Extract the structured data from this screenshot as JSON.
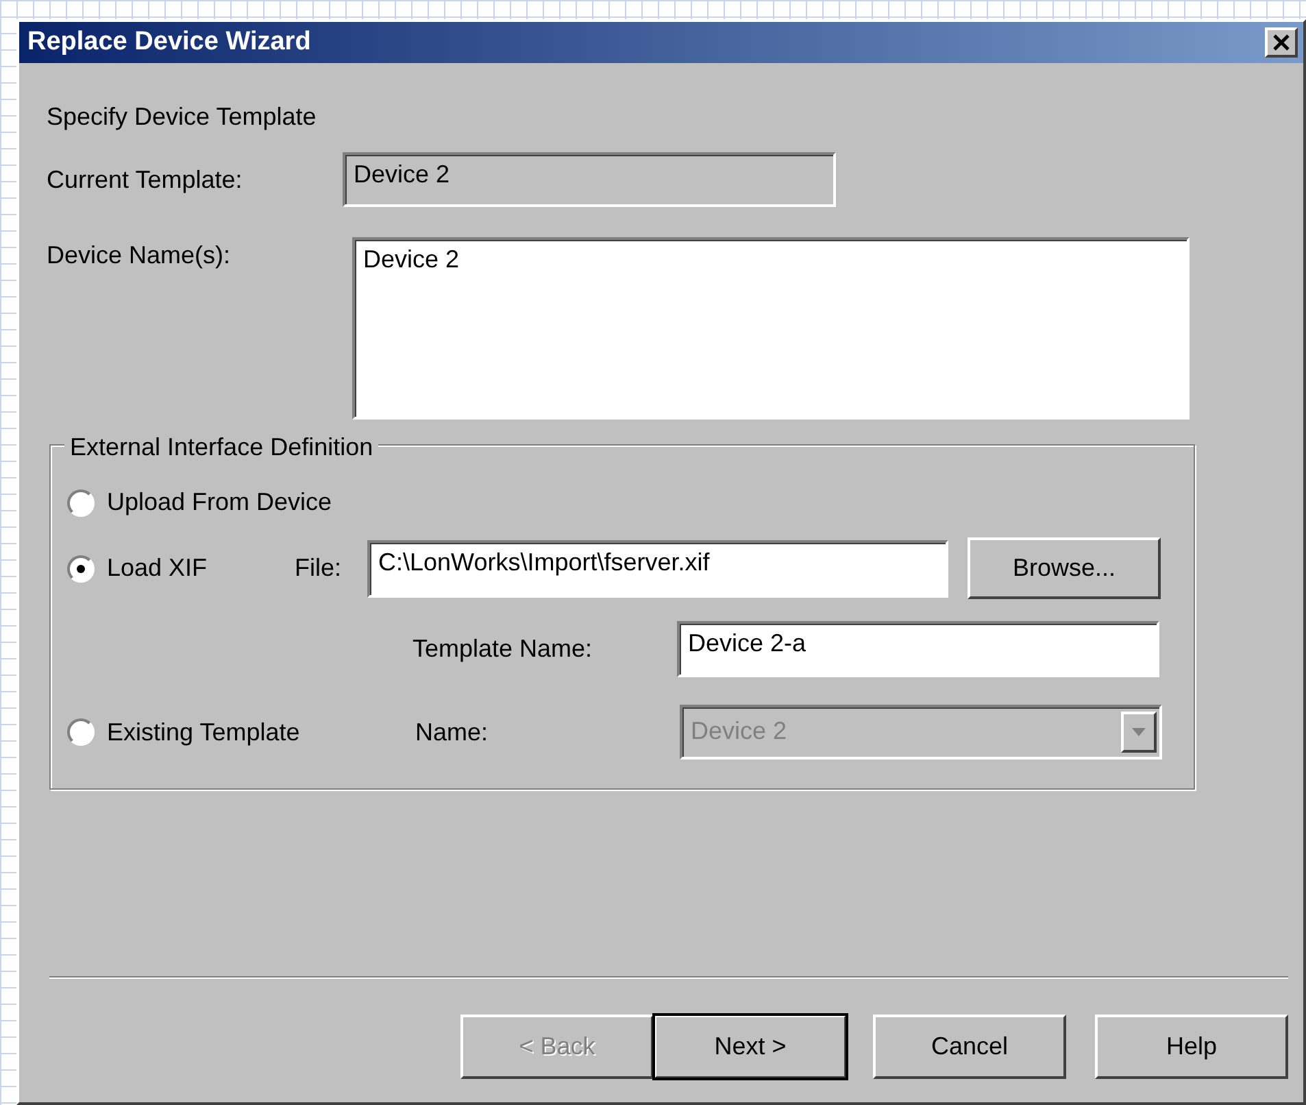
{
  "window": {
    "title": "Replace Device Wizard"
  },
  "heading": "Specify Device Template",
  "current_template": {
    "label": "Current Template:",
    "value": "Device 2",
    "readonly": true
  },
  "device_names": {
    "label": "Device Name(s):",
    "value": "Device 2"
  },
  "group": {
    "legend": "External Interface Definition",
    "options": [
      {
        "kind": "plain",
        "label": "Upload From Device",
        "selected": false
      },
      {
        "kind": "xif",
        "label": "Load XIF",
        "selected": true,
        "file_label": "File:",
        "file_value": "C:\\LonWorks\\Import\\fserver.xif",
        "browse": "Browse...",
        "template_label": "Template Name:",
        "template_value": "Device 2-a"
      },
      {
        "kind": "existing",
        "label": "Existing Template",
        "selected": false,
        "name_label": "Name:",
        "name_value": "Device 2",
        "disabled": true
      }
    ]
  },
  "buttons": [
    {
      "label": "< Back",
      "disabled": true,
      "default": false
    },
    {
      "label": "Next >",
      "disabled": false,
      "default": true
    },
    {
      "label": "Cancel",
      "disabled": false,
      "default": false
    },
    {
      "label": "Help",
      "disabled": false,
      "default": false
    }
  ]
}
